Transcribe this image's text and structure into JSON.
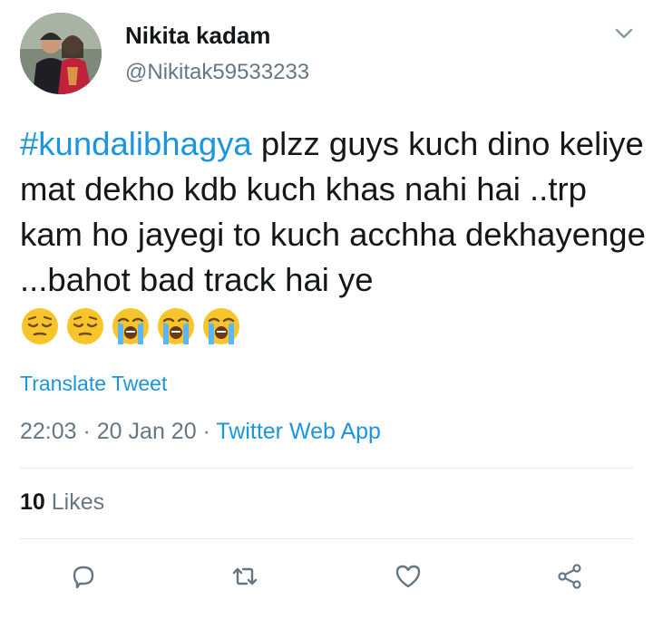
{
  "tweet": {
    "author_name": "Nikita kadam",
    "author_handle": "@Nikitak59533233",
    "hashtag": "#kundalibhagya",
    "text": " plzz guys kuch dino keliye mat dekho kdb kuch khas nahi hai ..trp kam ho jayegi to kuch acchha dekhayenge ...bahot bad track hai ye",
    "emojis": [
      "pensive-face",
      "pensive-face",
      "loudly-crying-face",
      "loudly-crying-face",
      "loudly-crying-face"
    ],
    "translate_label": "Translate Tweet",
    "time": "22:03",
    "date": "20 Jan 20",
    "source": "Twitter Web App",
    "separator": " · ",
    "likes_count": "10",
    "likes_label": " Likes"
  },
  "actions": {
    "icons": [
      "reply-icon",
      "retweet-icon",
      "like-icon",
      "share-icon"
    ]
  },
  "colors": {
    "link": "#1b95e0",
    "secondary_text": "#657786",
    "primary_text": "#14171a",
    "divider": "#e1e8ed"
  }
}
